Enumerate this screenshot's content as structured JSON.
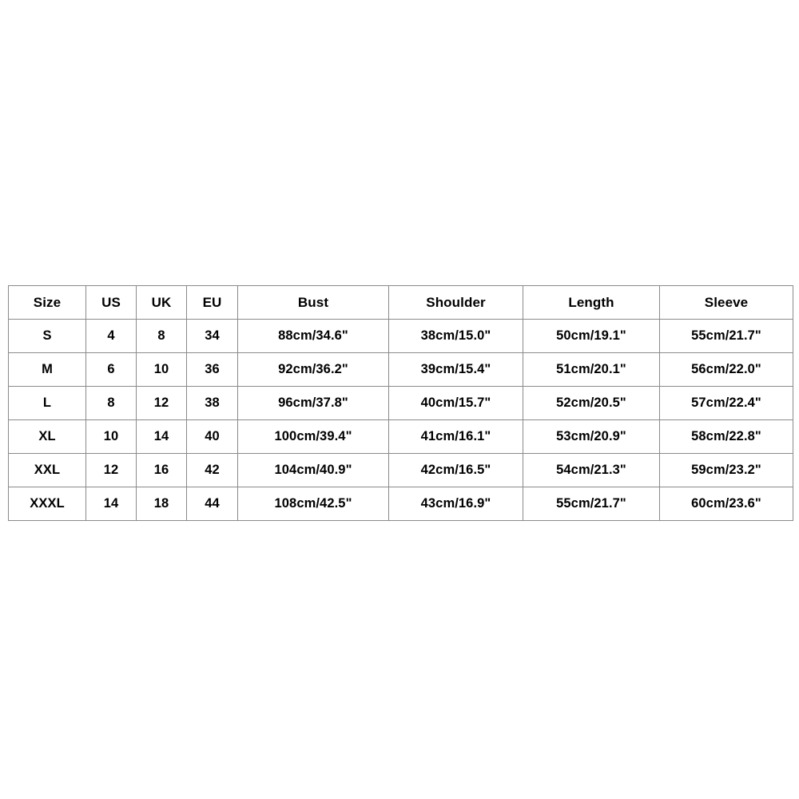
{
  "page": {
    "background_color": "#ffffff",
    "text_color": "#000000",
    "border_color": "#8a8a8a"
  },
  "size_chart": {
    "columns": [
      "Size",
      "US",
      "UK",
      "EU",
      "Bust",
      "Shoulder",
      "Length",
      "Sleeve"
    ],
    "rows": [
      {
        "size": "S",
        "us": "4",
        "uk": "8",
        "eu": "34",
        "bust": "88cm/34.6\"",
        "shoulder": "38cm/15.0\"",
        "length": "50cm/19.1\"",
        "sleeve": "55cm/21.7\""
      },
      {
        "size": "M",
        "us": "6",
        "uk": "10",
        "eu": "36",
        "bust": "92cm/36.2\"",
        "shoulder": "39cm/15.4\"",
        "length": "51cm/20.1\"",
        "sleeve": "56cm/22.0\""
      },
      {
        "size": "L",
        "us": "8",
        "uk": "12",
        "eu": "38",
        "bust": "96cm/37.8\"",
        "shoulder": "40cm/15.7\"",
        "length": "52cm/20.5\"",
        "sleeve": "57cm/22.4\""
      },
      {
        "size": "XL",
        "us": "10",
        "uk": "14",
        "eu": "40",
        "bust": "100cm/39.4\"",
        "shoulder": "41cm/16.1\"",
        "length": "53cm/20.9\"",
        "sleeve": "58cm/22.8\""
      },
      {
        "size": "XXL",
        "us": "12",
        "uk": "16",
        "eu": "42",
        "bust": "104cm/40.9\"",
        "shoulder": "42cm/16.5\"",
        "length": "54cm/21.3\"",
        "sleeve": "59cm/23.2\""
      },
      {
        "size": "XXXL",
        "us": "14",
        "uk": "18",
        "eu": "44",
        "bust": "108cm/42.5\"",
        "shoulder": "43cm/16.9\"",
        "length": "55cm/21.7\"",
        "sleeve": "60cm/23.6\""
      }
    ]
  }
}
